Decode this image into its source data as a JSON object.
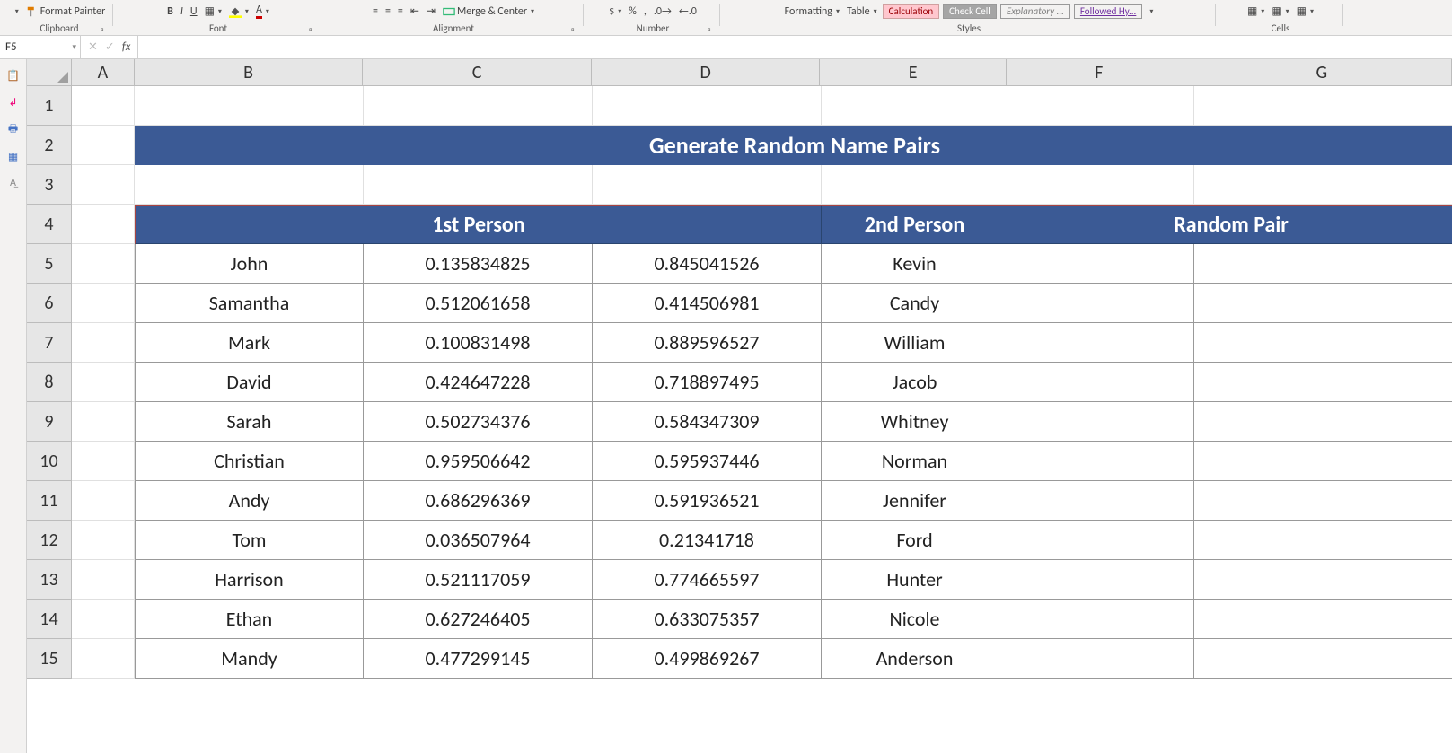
{
  "ribbon": {
    "format_painter": "Format Painter",
    "clipboard_label": "Clipboard",
    "font_label": "Font",
    "alignment_label": "Alignment",
    "number_label": "Number",
    "styles_label": "Styles",
    "cells_label": "Cells",
    "merge_center": "Merge & Center",
    "conditional_formatting": "Formatting",
    "format_table": "Table",
    "style_bad": "Calculation",
    "style_check": "Check Cell",
    "style_explanatory": "Explanatory ...",
    "style_followed": "Followed Hy..."
  },
  "namebox": "F5",
  "fx_label": "fx",
  "columns": [
    "A",
    "B",
    "C",
    "D",
    "E",
    "F",
    "G"
  ],
  "rows": [
    "1",
    "2",
    "3",
    "4",
    "5",
    "6",
    "7",
    "8",
    "9",
    "10",
    "11",
    "12",
    "13",
    "14",
    "15"
  ],
  "title": "Generate Random Name Pairs",
  "headers": {
    "person1": "1st Person",
    "person2": "2nd Person",
    "random_pair": "Random Pair"
  },
  "data": [
    {
      "p1": "John",
      "c": "0.135834825",
      "d": "0.845041526",
      "p2": "Kevin"
    },
    {
      "p1": "Samantha",
      "c": "0.512061658",
      "d": "0.414506981",
      "p2": "Candy"
    },
    {
      "p1": "Mark",
      "c": "0.100831498",
      "d": "0.889596527",
      "p2": "William"
    },
    {
      "p1": "David",
      "c": "0.424647228",
      "d": "0.718897495",
      "p2": "Jacob"
    },
    {
      "p1": "Sarah",
      "c": "0.502734376",
      "d": "0.584347309",
      "p2": "Whitney"
    },
    {
      "p1": "Christian",
      "c": "0.959506642",
      "d": "0.595937446",
      "p2": "Norman"
    },
    {
      "p1": "Andy",
      "c": "0.686296369",
      "d": "0.591936521",
      "p2": "Jennifer"
    },
    {
      "p1": "Tom",
      "c": "0.036507964",
      "d": "0.21341718",
      "p2": "Ford"
    },
    {
      "p1": "Harrison",
      "c": "0.521117059",
      "d": "0.774665597",
      "p2": "Hunter"
    },
    {
      "p1": "Ethan",
      "c": "0.627246405",
      "d": "0.633075357",
      "p2": "Nicole"
    },
    {
      "p1": "Mandy",
      "c": "0.477299145",
      "d": "0.499869267",
      "p2": "Anderson"
    }
  ]
}
